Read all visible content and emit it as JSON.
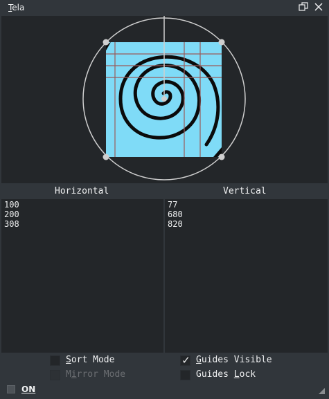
{
  "window": {
    "title_first": "T",
    "title_rest": "ela",
    "float_icon": "restore-icon",
    "close_icon": "close-icon"
  },
  "colors": {
    "bg": "#31363b",
    "panel": "#232629",
    "canvas_fill": "#7fdbf7",
    "guide_line": "#9a5a5a",
    "circle": "#cfcfcf"
  },
  "headers": {
    "horizontal": "Horizontal",
    "vertical": "Vertical"
  },
  "lists": {
    "horizontal": [
      "100",
      "200",
      "308"
    ],
    "vertical": [
      "77",
      "680",
      "820"
    ]
  },
  "options": {
    "sort_mode": {
      "mnemonic": "S",
      "rest": "ort Mode",
      "checked": false,
      "enabled": true
    },
    "mirror_mode": {
      "pre": "M",
      "mnemonic": "i",
      "rest": "rror Mode",
      "checked": false,
      "enabled": false
    },
    "guides_visible": {
      "mnemonic": "G",
      "rest": "uides Visible",
      "checked": true,
      "enabled": true
    },
    "guides_lock": {
      "pre": "Guides ",
      "mnemonic": "L",
      "rest": "ock",
      "checked": false,
      "enabled": true
    }
  },
  "footer": {
    "toggle_label": "ON",
    "toggle_checked": false,
    "resize_icon": "resize-grip-icon"
  }
}
